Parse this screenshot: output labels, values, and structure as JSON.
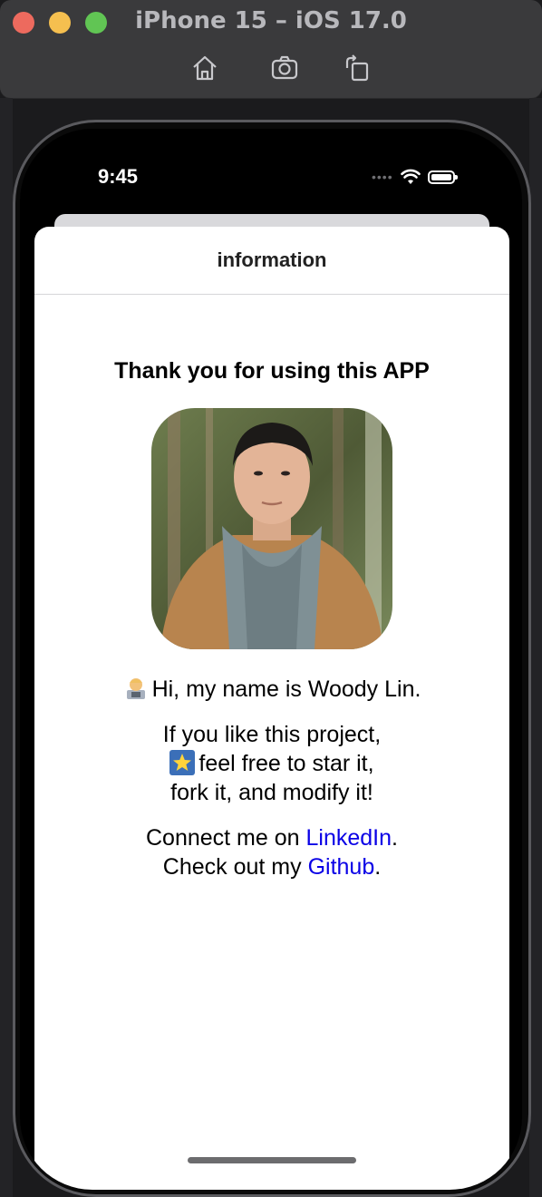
{
  "window": {
    "title": "iPhone 15 – iOS 17.0",
    "toolbar": [
      {
        "name": "home-icon"
      },
      {
        "name": "screenshot-camera-icon"
      },
      {
        "name": "rotate-icon"
      }
    ]
  },
  "status_bar": {
    "time": "9:45",
    "icons": [
      "signal-dots-icon",
      "wifi-icon",
      "battery-icon"
    ]
  },
  "sheet": {
    "title": "information",
    "heading": "Thank you for using this APP",
    "intro": "Hi, my name is Woody Lin.",
    "intro_emoji": "technologist-emoji",
    "project_line1": "If you like this project,",
    "project_line2": "feel free to star it,",
    "project_line2_emoji": "glowing-star-emoji",
    "project_line3": "fork it, and modify it!",
    "connect_prefix": "Connect me on ",
    "linkedin_label": "LinkedIn",
    "connect_suffix": ".",
    "github_prefix": "Check out my ",
    "github_label": "Github",
    "github_suffix": "."
  },
  "colors": {
    "link": "#0a00e6",
    "sheet_bg": "#ffffff",
    "window_chrome": "#3a3a3c"
  }
}
